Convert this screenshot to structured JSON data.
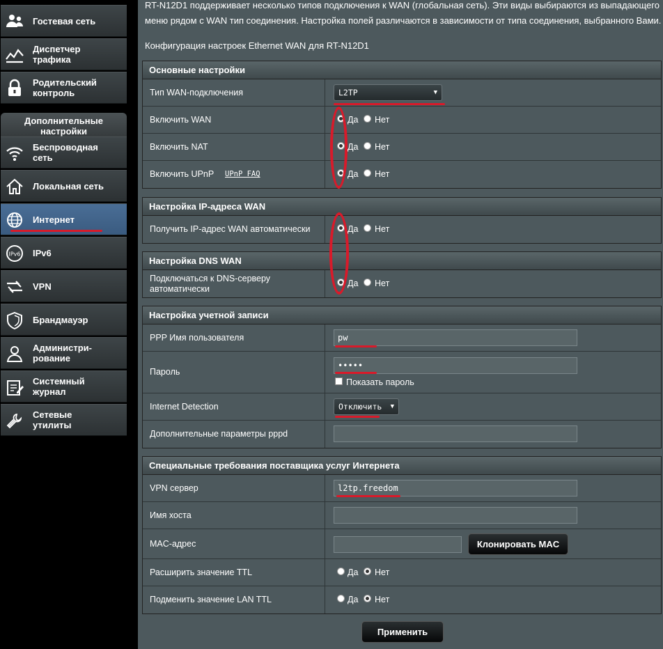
{
  "sidebar": {
    "items_top": [
      {
        "label": "Гостевая сеть",
        "icon": "guest-network-icon"
      },
      {
        "label": "Диспетчер трафика",
        "icon": "traffic-manager-icon"
      },
      {
        "label": "Родительский контроль",
        "icon": "lock-icon"
      }
    ],
    "section_title": "Дополнительные настройки",
    "items": [
      {
        "label": "Беспроводная сеть",
        "icon": "wifi-icon"
      },
      {
        "label": "Локальная сеть",
        "icon": "home-icon"
      },
      {
        "label": "Интернет",
        "icon": "globe-icon",
        "active": true
      },
      {
        "label": "IPv6",
        "icon": "ipv6-icon"
      },
      {
        "label": "VPN",
        "icon": "vpn-icon"
      },
      {
        "label": "Брандмауэр",
        "icon": "shield-icon"
      },
      {
        "label": "Администри-рование",
        "icon": "admin-user-icon"
      },
      {
        "label": "Системный журнал",
        "icon": "system-log-icon"
      },
      {
        "label": "Сетевые утилиты",
        "icon": "wrench-icon"
      }
    ]
  },
  "intro": {
    "line1": "RT-N12D1 поддерживает несколько типов подключения к WAN (глобальная сеть). Эти виды выбираются из выпадающего",
    "line2": "меню рядом с WAN тип соединения. Настройка полей различаются в зависимости от типа соединения, выбранного Вами.",
    "config_title": "Конфигурация настроек Ethernet WAN для RT-N12D1"
  },
  "radio_yes": "Да",
  "radio_no": "Нет",
  "basic": {
    "title": "Основные настройки",
    "wan_type_label": "Тип WAN-подключения",
    "wan_type_value": "L2TP",
    "enable_wan_label": "Включить WAN",
    "enable_nat_label": "Включить NAT",
    "enable_upnp_label": "Включить UPnP",
    "upnp_faq": "UPnP  FAQ"
  },
  "ip": {
    "title": "Настройка IP-адреса WAN",
    "auto_ip_label": "Получить IP-адрес WAN автоматически"
  },
  "dns": {
    "title": "Настройка DNS WAN",
    "auto_dns_label": "Подключаться к DNS-серверу автоматически"
  },
  "account": {
    "title": "Настройка учетной записи",
    "username_label": "PPP Имя пользователя",
    "username_value": "pw",
    "password_label": "Пароль",
    "password_value": "•••••",
    "show_password": "Показать пароль",
    "detection_label": "Internet Detection",
    "detection_value": "Отключить",
    "pppd_label": "Дополнительные параметры pppd",
    "pppd_value": ""
  },
  "isp": {
    "title": "Специальные требования поставщика услуг Интернета",
    "vpn_label": "VPN сервер",
    "vpn_value": "l2tp.freedom",
    "host_label": "Имя хоста",
    "host_value": "",
    "mac_label": "MAC-адрес",
    "mac_value": "",
    "clone_mac": "Клонировать MAC",
    "ttl_label": "Расширить значение TTL",
    "lan_ttl_label": "Подменить значение LAN TTL"
  },
  "apply_button": "Применить",
  "colors": {
    "annotation_red": "#d91a2a",
    "active_nav": "#4a6e96",
    "panel_bg": "#4d595d"
  }
}
